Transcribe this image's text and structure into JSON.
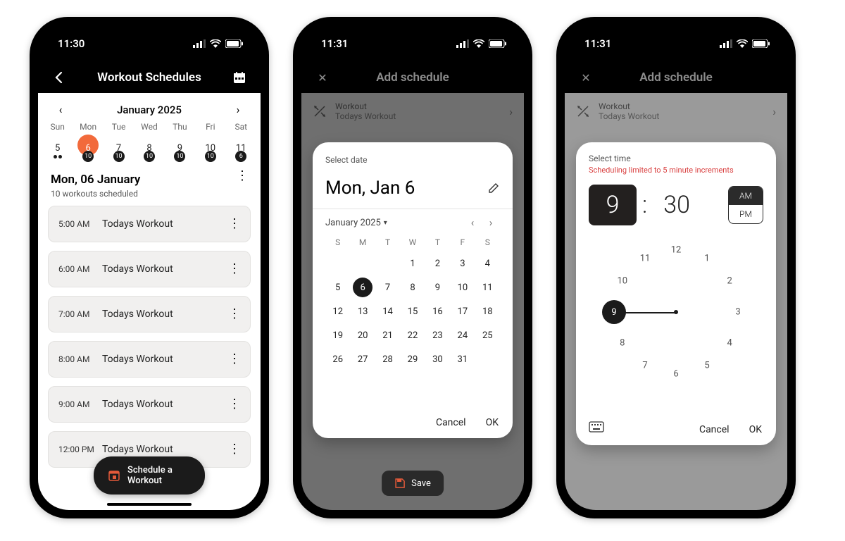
{
  "statusbar": {
    "time1": "11:30",
    "time2": "11:31",
    "time3": "11:31"
  },
  "phone1": {
    "header_title": "Workout Schedules",
    "month_label": "January 2025",
    "dow": [
      "Sun",
      "Mon",
      "Tue",
      "Wed",
      "Thu",
      "Fri",
      "Sat"
    ],
    "days": [
      {
        "n": "5",
        "badge": "",
        "dots": 2
      },
      {
        "n": "6",
        "badge": "10",
        "sel": true
      },
      {
        "n": "7",
        "badge": "10"
      },
      {
        "n": "8",
        "badge": "10"
      },
      {
        "n": "9",
        "badge": "10"
      },
      {
        "n": "10",
        "badge": "10"
      },
      {
        "n": "11",
        "badge": "6"
      }
    ],
    "selected_date": "Mon, 06 January",
    "selected_sub": "10 workouts scheduled",
    "workouts": [
      {
        "time": "5:00 AM",
        "name": "Todays Workout"
      },
      {
        "time": "6:00 AM",
        "name": "Todays Workout"
      },
      {
        "time": "7:00 AM",
        "name": "Todays Workout"
      },
      {
        "time": "8:00 AM",
        "name": "Todays Workout"
      },
      {
        "time": "9:00 AM",
        "name": "Todays Workout"
      },
      {
        "time": "12:00 PM",
        "name": "Todays Workout"
      }
    ],
    "fab_label": "Schedule a Workout"
  },
  "add_schedule": {
    "header_title": "Add schedule",
    "row_label": "Workout",
    "row_value": "Todays Workout",
    "save_label": "Save"
  },
  "date_picker": {
    "select_label": "Select date",
    "big_date": "Mon, Jan 6",
    "month_label": "January 2025",
    "dow": [
      "S",
      "M",
      "T",
      "W",
      "T",
      "F",
      "S"
    ],
    "weeks": [
      [
        "",
        "",
        "",
        "1",
        "2",
        "3",
        "4"
      ],
      [
        "5",
        "6",
        "7",
        "8",
        "9",
        "10",
        "11"
      ],
      [
        "12",
        "13",
        "14",
        "15",
        "16",
        "17",
        "18"
      ],
      [
        "19",
        "20",
        "21",
        "22",
        "23",
        "24",
        "25"
      ],
      [
        "26",
        "27",
        "28",
        "29",
        "30",
        "31",
        ""
      ]
    ],
    "selected_day": "6",
    "cancel": "Cancel",
    "ok": "OK"
  },
  "time_picker": {
    "select_label": "Select time",
    "warn": "Scheduling limited to 5 minute increments",
    "hour": "9",
    "minute": "30",
    "am": "AM",
    "pm": "PM",
    "selected_period": "AM",
    "cancel": "Cancel",
    "ok": "OK",
    "clock_numbers": [
      "12",
      "1",
      "2",
      "3",
      "4",
      "5",
      "6",
      "7",
      "8",
      "9",
      "10",
      "11"
    ],
    "selected_clock": "9"
  }
}
